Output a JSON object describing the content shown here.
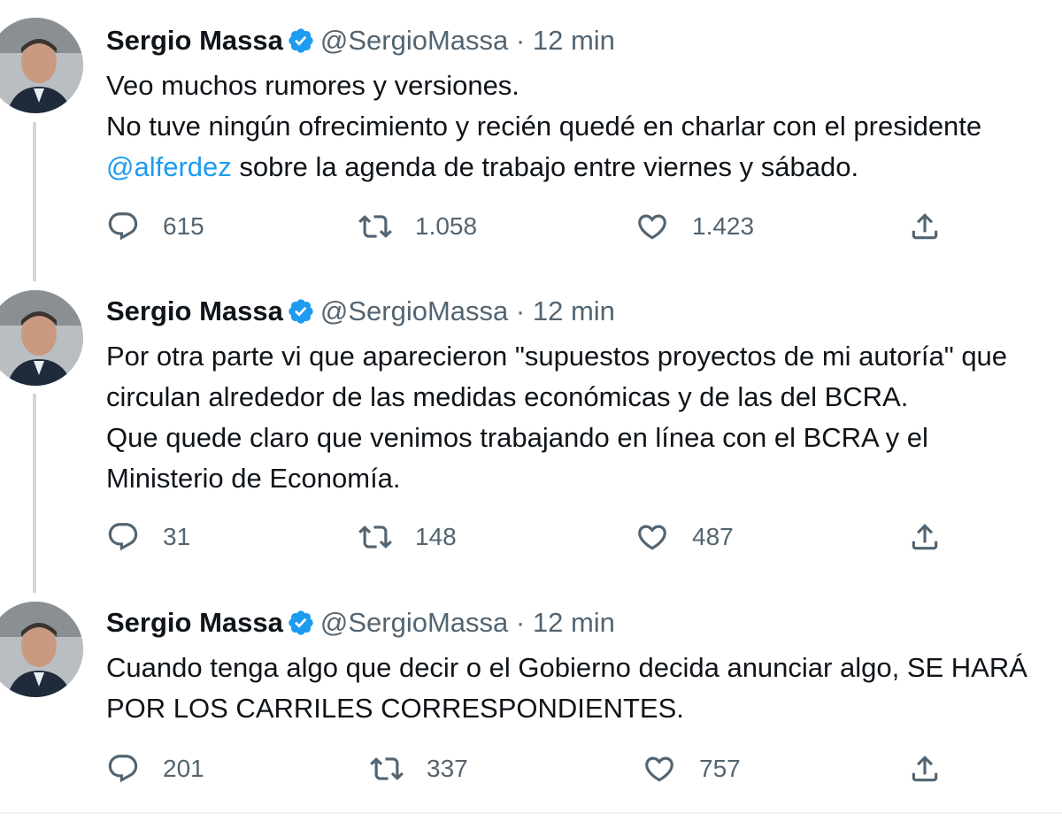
{
  "colors": {
    "text": "#0f1419",
    "secondary": "#536471",
    "link": "#1d9bf0",
    "verified": "#1d9bf0",
    "thread_line": "#cfd9de"
  },
  "tweets": [
    {
      "author": "Sergio Massa",
      "handle": "@SergioMassa",
      "separator": "·",
      "time": "12 min",
      "lines": {
        "l1": "Veo muchos rumores y versiones.",
        "l2": "No tuve ningún ofrecimiento y recién quedé en charlar con el presidente",
        "l3_mention": "@alferdez",
        "l3_rest": " sobre la agenda de trabajo entre viernes y sábado."
      },
      "replies": "615",
      "retweets": "1.058",
      "likes": "1.423"
    },
    {
      "author": "Sergio Massa",
      "handle": "@SergioMassa",
      "separator": "·",
      "time": "12 min",
      "lines": {
        "l1": "Por otra parte vi que aparecieron \"supuestos proyectos de mi autoría\" que",
        "l2": "circulan alrededor de las medidas económicas y de las del BCRA.",
        "l3": "Que quede claro que venimos trabajando en línea con el BCRA y el",
        "l4": "Ministerio de Economía."
      },
      "replies": "31",
      "retweets": "148",
      "likes": "487"
    },
    {
      "author": "Sergio Massa",
      "handle": "@SergioMassa",
      "separator": "·",
      "time": "12 min",
      "lines": {
        "l1": "Cuando tenga algo que decir o el Gobierno decida anunciar algo, SE HARÁ",
        "l2": "POR LOS CARRILES CORRESPONDIENTES."
      },
      "replies": "201",
      "retweets": "337",
      "likes": "757"
    }
  ],
  "icons": {
    "reply": "reply-icon",
    "retweet": "retweet-icon",
    "like": "heart-icon",
    "share": "share-icon",
    "verified": "verified-badge-icon"
  }
}
